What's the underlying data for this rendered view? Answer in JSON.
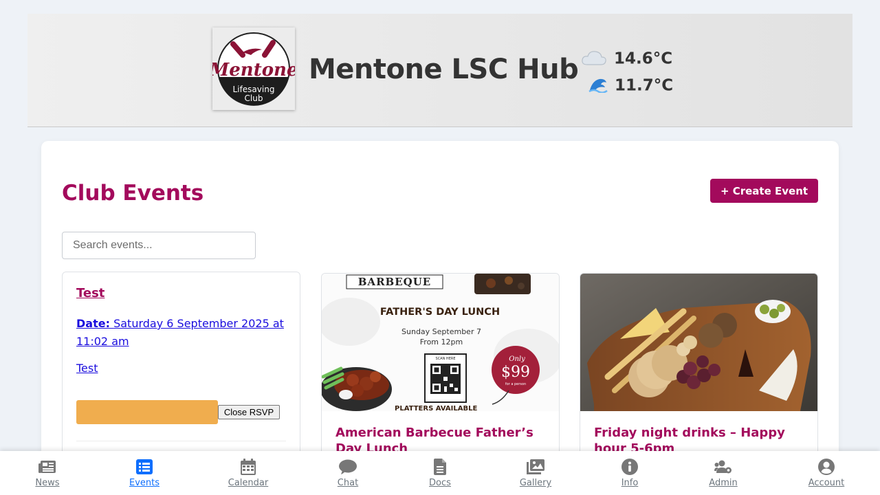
{
  "header": {
    "site_title": "Mentone LSC Hub",
    "logo_text": {
      "line1": "Mentone",
      "line2": "Lifesaving",
      "line3": "Club"
    },
    "weather": {
      "air_temp": "14.6°C",
      "water_temp": "11.7°C",
      "air_icon": "cloud-icon",
      "water_icon": "wave-icon"
    }
  },
  "main": {
    "title": "Club Events",
    "create_button": "+ Create Event",
    "search_placeholder": "Search events..."
  },
  "events": [
    {
      "title": "Test",
      "date_label": "Date:",
      "date_value": "Saturday 6 September 2025 at 11:02 am",
      "description": "Test",
      "close_rsvp": "Close RSVP"
    },
    {
      "title": "American Barbecue Father’s Day Lunch",
      "image": {
        "heading": "BARBEQUE",
        "subheading": "FATHER'S DAY LUNCH",
        "date_line": "Sunday September 7",
        "time_line": "From 12pm",
        "scan_label": "SCAN HERE",
        "price_top": "Only",
        "price": "$99",
        "price_bottom": "for a person",
        "footer": "PLATTERS AVAILABLE"
      }
    },
    {
      "title": "Friday night drinks – Happy hour 5-6pm",
      "image_icon": "cheese-platter-photo"
    }
  ],
  "nav": [
    {
      "label": "News",
      "icon": "newspaper-icon"
    },
    {
      "label": "Events",
      "icon": "list-icon",
      "active": true
    },
    {
      "label": "Calendar",
      "icon": "calendar-icon"
    },
    {
      "label": "Chat",
      "icon": "chat-icon"
    },
    {
      "label": "Docs",
      "icon": "document-icon"
    },
    {
      "label": "Gallery",
      "icon": "images-icon"
    },
    {
      "label": "Info",
      "icon": "info-icon"
    },
    {
      "label": "Admin",
      "icon": "users-cog-icon"
    },
    {
      "label": "Account",
      "icon": "user-circle-icon"
    }
  ],
  "colors": {
    "brand": "#a30a5c",
    "active_nav": "#0d6efd",
    "rsvp": "#f0ad4e"
  }
}
